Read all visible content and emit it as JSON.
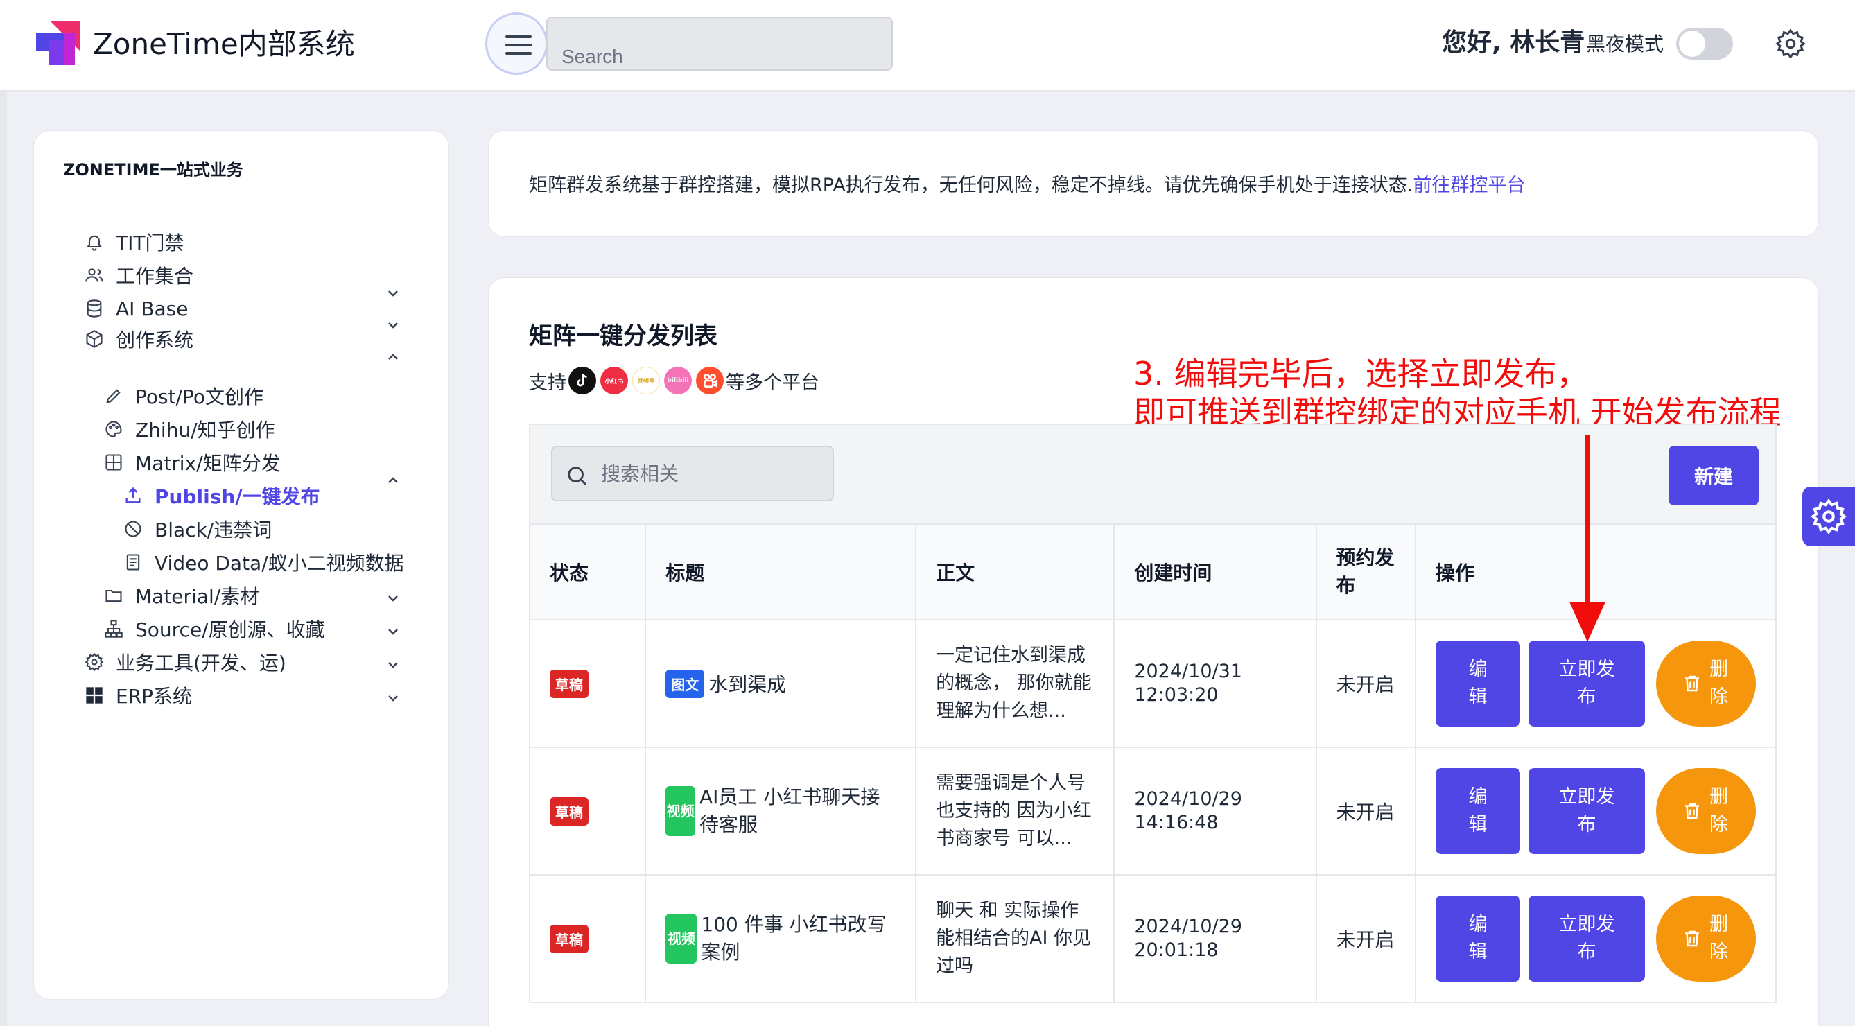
{
  "header": {
    "brand": "ZoneTime内部系统",
    "search_placeholder": "Search",
    "greeting": "您好, 林长青",
    "night_mode_label": "黑夜模式"
  },
  "sidebar": {
    "section_title": "ZONETIME一站式业务",
    "items": [
      {
        "label": "TIT门禁",
        "icon": "bell-icon"
      },
      {
        "label": "工作集合",
        "icon": "users-icon"
      },
      {
        "label": "AI Base",
        "icon": "database-icon"
      },
      {
        "label": "创作系统",
        "icon": "cube-icon"
      },
      {
        "label": "Post/Po文创作",
        "icon": "pencil-icon"
      },
      {
        "label": "Zhihu/知乎创作",
        "icon": "palette-icon"
      },
      {
        "label": "Matrix/矩阵分发",
        "icon": "grid-icon"
      },
      {
        "label": "Publish/一键发布",
        "icon": "upload-icon",
        "active": true
      },
      {
        "label": "Black/违禁词",
        "icon": "ban-icon"
      },
      {
        "label": "Video Data/蚁小二视频数据",
        "icon": "document-icon"
      },
      {
        "label": "Material/素材",
        "icon": "folder-icon"
      },
      {
        "label": "Source/原创源、收藏",
        "icon": "sitemap-icon"
      },
      {
        "label": "业务工具(开发、运)",
        "icon": "gear-icon"
      },
      {
        "label": "ERP系统",
        "icon": "windows-icon"
      }
    ]
  },
  "notice": {
    "text": "矩阵群发系统基于群控搭建，模拟RPA执行发布，无任何风险，稳定不掉线。请优先确保手机处于连接状态.",
    "link": "前往群控平台"
  },
  "main": {
    "title": "矩阵一键分发列表",
    "support_prefix": "支持",
    "support_suffix": "等多个平台",
    "platform_badges": [
      "小红书",
      "视频号",
      "bilibili"
    ],
    "search_placeholder": "搜索相关",
    "new_button": "新建",
    "annotation_line1": "3. 编辑完毕后，选择立即发布，",
    "annotation_line2": "即可推送到群控绑定的对应手机 开始发布流程"
  },
  "table": {
    "columns": [
      "状态",
      "标题",
      "正文",
      "创建时间",
      "预约发布",
      "操作"
    ],
    "rows": [
      {
        "status": "草稿",
        "type": "图文",
        "title": "水到渠成",
        "body": "一定记住水到渠成的概念， 那你就能理解为什么想...",
        "created": "2024/10/31 12:03:20",
        "schedule": "未开启"
      },
      {
        "status": "草稿",
        "type": "视频",
        "title": "AI员工 小红书聊天接待客服",
        "body": "需要强调是个人号也支持的 因为小红书商家号 可以...",
        "created": "2024/10/29 14:16:48",
        "schedule": "未开启"
      },
      {
        "status": "草稿",
        "type": "视频",
        "title": "100 件事 小红书改写案例",
        "body": "聊天 和 实际操作能相结合的AI 你见过吗",
        "created": "2024/10/29 20:01:18",
        "schedule": "未开启"
      }
    ],
    "actions": {
      "edit": "编辑",
      "publish": "立即发布",
      "delete": "删除"
    }
  },
  "colors": {
    "accent": "#4f46e5",
    "danger": "#dc2626",
    "warning": "#f5960d",
    "annotation": "#f20d0d"
  }
}
